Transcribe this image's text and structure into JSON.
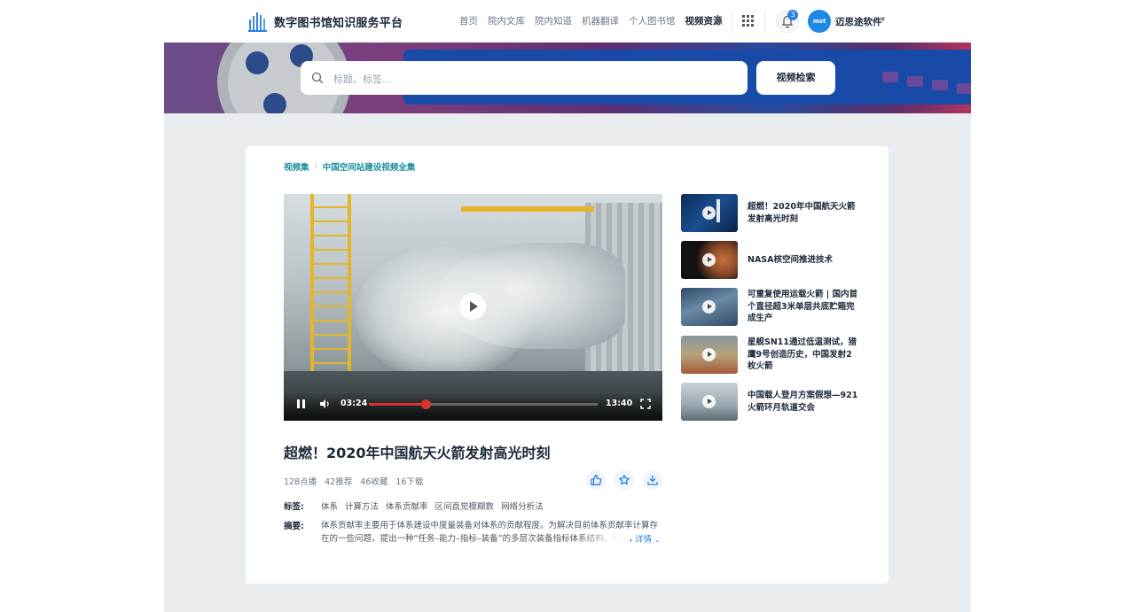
{
  "header": {
    "site_title": "数字图书馆知识服务平台",
    "nav": [
      "首页",
      "院内文库",
      "院内知道",
      "机器翻译",
      "个人图书馆",
      "视频资源"
    ],
    "active_nav": "视频资源",
    "notification_count": "3",
    "avatar_text": "mst",
    "username": "迈思途软件"
  },
  "search": {
    "placeholder": "标题、标签...",
    "button": "视频检索"
  },
  "breadcrumb": [
    "视频集",
    "中国空间站建设视频全集"
  ],
  "player": {
    "current_time": "03:24",
    "total_time": "13:40",
    "progress": 0.249
  },
  "video": {
    "title": "超燃！2020年中国航天火箭发射高光时刻",
    "stats": [
      "128点播",
      "42推荐",
      "46收藏",
      "16下载"
    ],
    "tags_label": "标签:",
    "tags": [
      "体系",
      "计算方法",
      "体系贡献率",
      "区间直觉模糊数",
      "网络分析法"
    ],
    "abstract_label": "摘要:",
    "abstract": "体系贡献率主要用于体系建设中度量装备对体系的贡献程度。为解决目前体系贡献率计算存在的一些问题，提出一种“任务–能力–指标–装备”的多层次装备指标体系结构。同时，",
    "more": "详情"
  },
  "related": [
    {
      "title": "超燃！2020年中国航天火箭发射高光时刻"
    },
    {
      "title": "NASA核空间推进技术"
    },
    {
      "title": "可重复使用运载火箭 | 国内首个直径超3米单层共底贮箱完成生产"
    },
    {
      "title": "星舰SN11通过低温测试，猎鹰9号创造历史，中国发射2枚火箭"
    },
    {
      "title": "中国载人登月方案假想—921火箭环月轨道交会"
    }
  ],
  "colors": {
    "accent": "#2b7de9",
    "breadcrumb": "#1a8fa0",
    "progress": "#d9342c",
    "page_bg": "#e9edf0"
  }
}
